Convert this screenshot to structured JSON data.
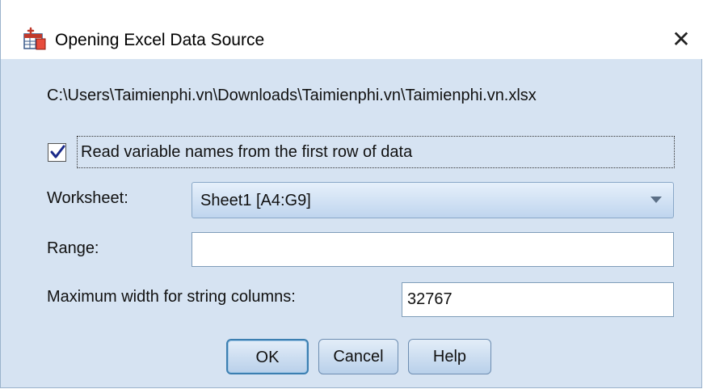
{
  "dialog": {
    "title": "Opening Excel Data Source",
    "close_glyph": "✕",
    "title_icon": "spss-data-icon"
  },
  "path": "C:\\Users\\Taimienphi.vn\\Downloads\\Taimienphi.vn\\Taimienphi.vn.xlsx",
  "checkbox": {
    "label": "Read variable names from the first row of data",
    "checked": true
  },
  "worksheet": {
    "label": "Worksheet:",
    "selected": "Sheet1 [A4:G9]"
  },
  "range": {
    "label": "Range:",
    "value": ""
  },
  "max_width": {
    "label": "Maximum width for string columns:",
    "value": "32767"
  },
  "buttons": {
    "ok": "OK",
    "cancel": "Cancel",
    "help": "Help"
  },
  "colors": {
    "dialog_bg": "#d6e3f2",
    "default_button_border": "#3c7fb1",
    "checkmark": "#1a2a8a"
  }
}
